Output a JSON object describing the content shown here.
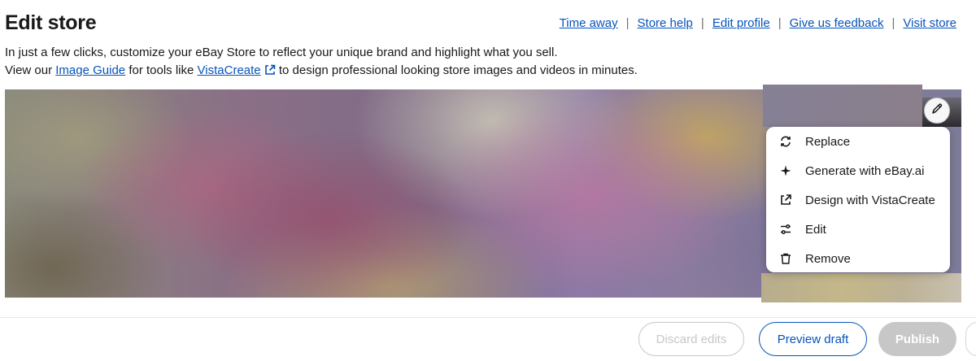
{
  "page": {
    "title": "Edit store"
  },
  "top_links": [
    {
      "label": "Time away"
    },
    {
      "label": "Store help"
    },
    {
      "label": "Edit profile"
    },
    {
      "label": "Give us feedback"
    },
    {
      "label": "Visit store"
    }
  ],
  "separator": "|",
  "intro": {
    "line1": "In just a few clicks, customize your eBay Store to reflect your unique brand and highlight what you sell.",
    "line2_prefix": "View our",
    "image_guide_link": "Image Guide",
    "line2_middle": "for tools like",
    "vistacreate_link": "VistaCreate",
    "line2_suffix": "to design professional looking store images and videos in minutes."
  },
  "banner_menu": {
    "items": [
      {
        "label": "Replace",
        "icon": "replace-icon"
      },
      {
        "label": "Generate with eBay.ai",
        "icon": "sparkle-icon"
      },
      {
        "label": "Design with VistaCreate",
        "icon": "external-link-icon"
      },
      {
        "label": "Edit",
        "icon": "sliders-icon"
      },
      {
        "label": "Remove",
        "icon": "trash-icon"
      }
    ]
  },
  "footer": {
    "discard_label": "Discard edits",
    "preview_label": "Preview draft",
    "publish_label": "Publish"
  },
  "colors": {
    "link": "#0654ba",
    "disabled": "#c7c7c7",
    "text": "#191919"
  }
}
